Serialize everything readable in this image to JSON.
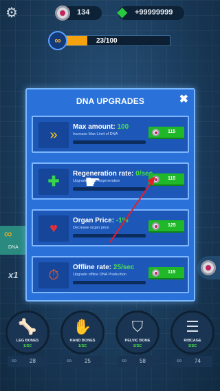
{
  "hud": {
    "coins": "134",
    "gems": "+99999999",
    "dna_progress_text": "23/100",
    "dna_progress_fraction": 0.23
  },
  "modal": {
    "title": "DNA UPGRADES",
    "close_label": "✖",
    "cards": [
      {
        "icon": "chevrons-icon",
        "title": "Max amount: ",
        "value": "100",
        "desc": "Increase Max Limit of DNA",
        "cost": "115"
      },
      {
        "icon": "plus-icon",
        "title": "Regeneration rate: ",
        "value": "0/sec",
        "desc": "Upgrade DNA Regeneration",
        "cost": "115"
      },
      {
        "icon": "organ-icon",
        "title": "Organ Price: ",
        "value": "-1%",
        "desc": "Decrease organ price",
        "cost": "125"
      },
      {
        "icon": "offline-clock-icon",
        "title": "Offline rate: ",
        "value": "25/sec",
        "desc": "Upgrade offline DNA Production",
        "cost": "115"
      }
    ]
  },
  "side": {
    "dna_label": "DNA",
    "multiplier": "x1"
  },
  "bones": [
    {
      "label": "LEG BONES",
      "rate": "1/SC",
      "cost": "28"
    },
    {
      "label": "HAND BONES",
      "rate": "1/SC",
      "cost": "25"
    },
    {
      "label": "PELVIC BONE",
      "rate": "2/SC",
      "cost": "58"
    },
    {
      "label": "RIBCAGE",
      "rate": "3/SC",
      "cost": "74"
    }
  ],
  "colors": {
    "accent_green": "#4be04a",
    "button_green": "#1fb829",
    "modal_blue": "#2a72d9",
    "progress_orange": "#f5a20e"
  }
}
